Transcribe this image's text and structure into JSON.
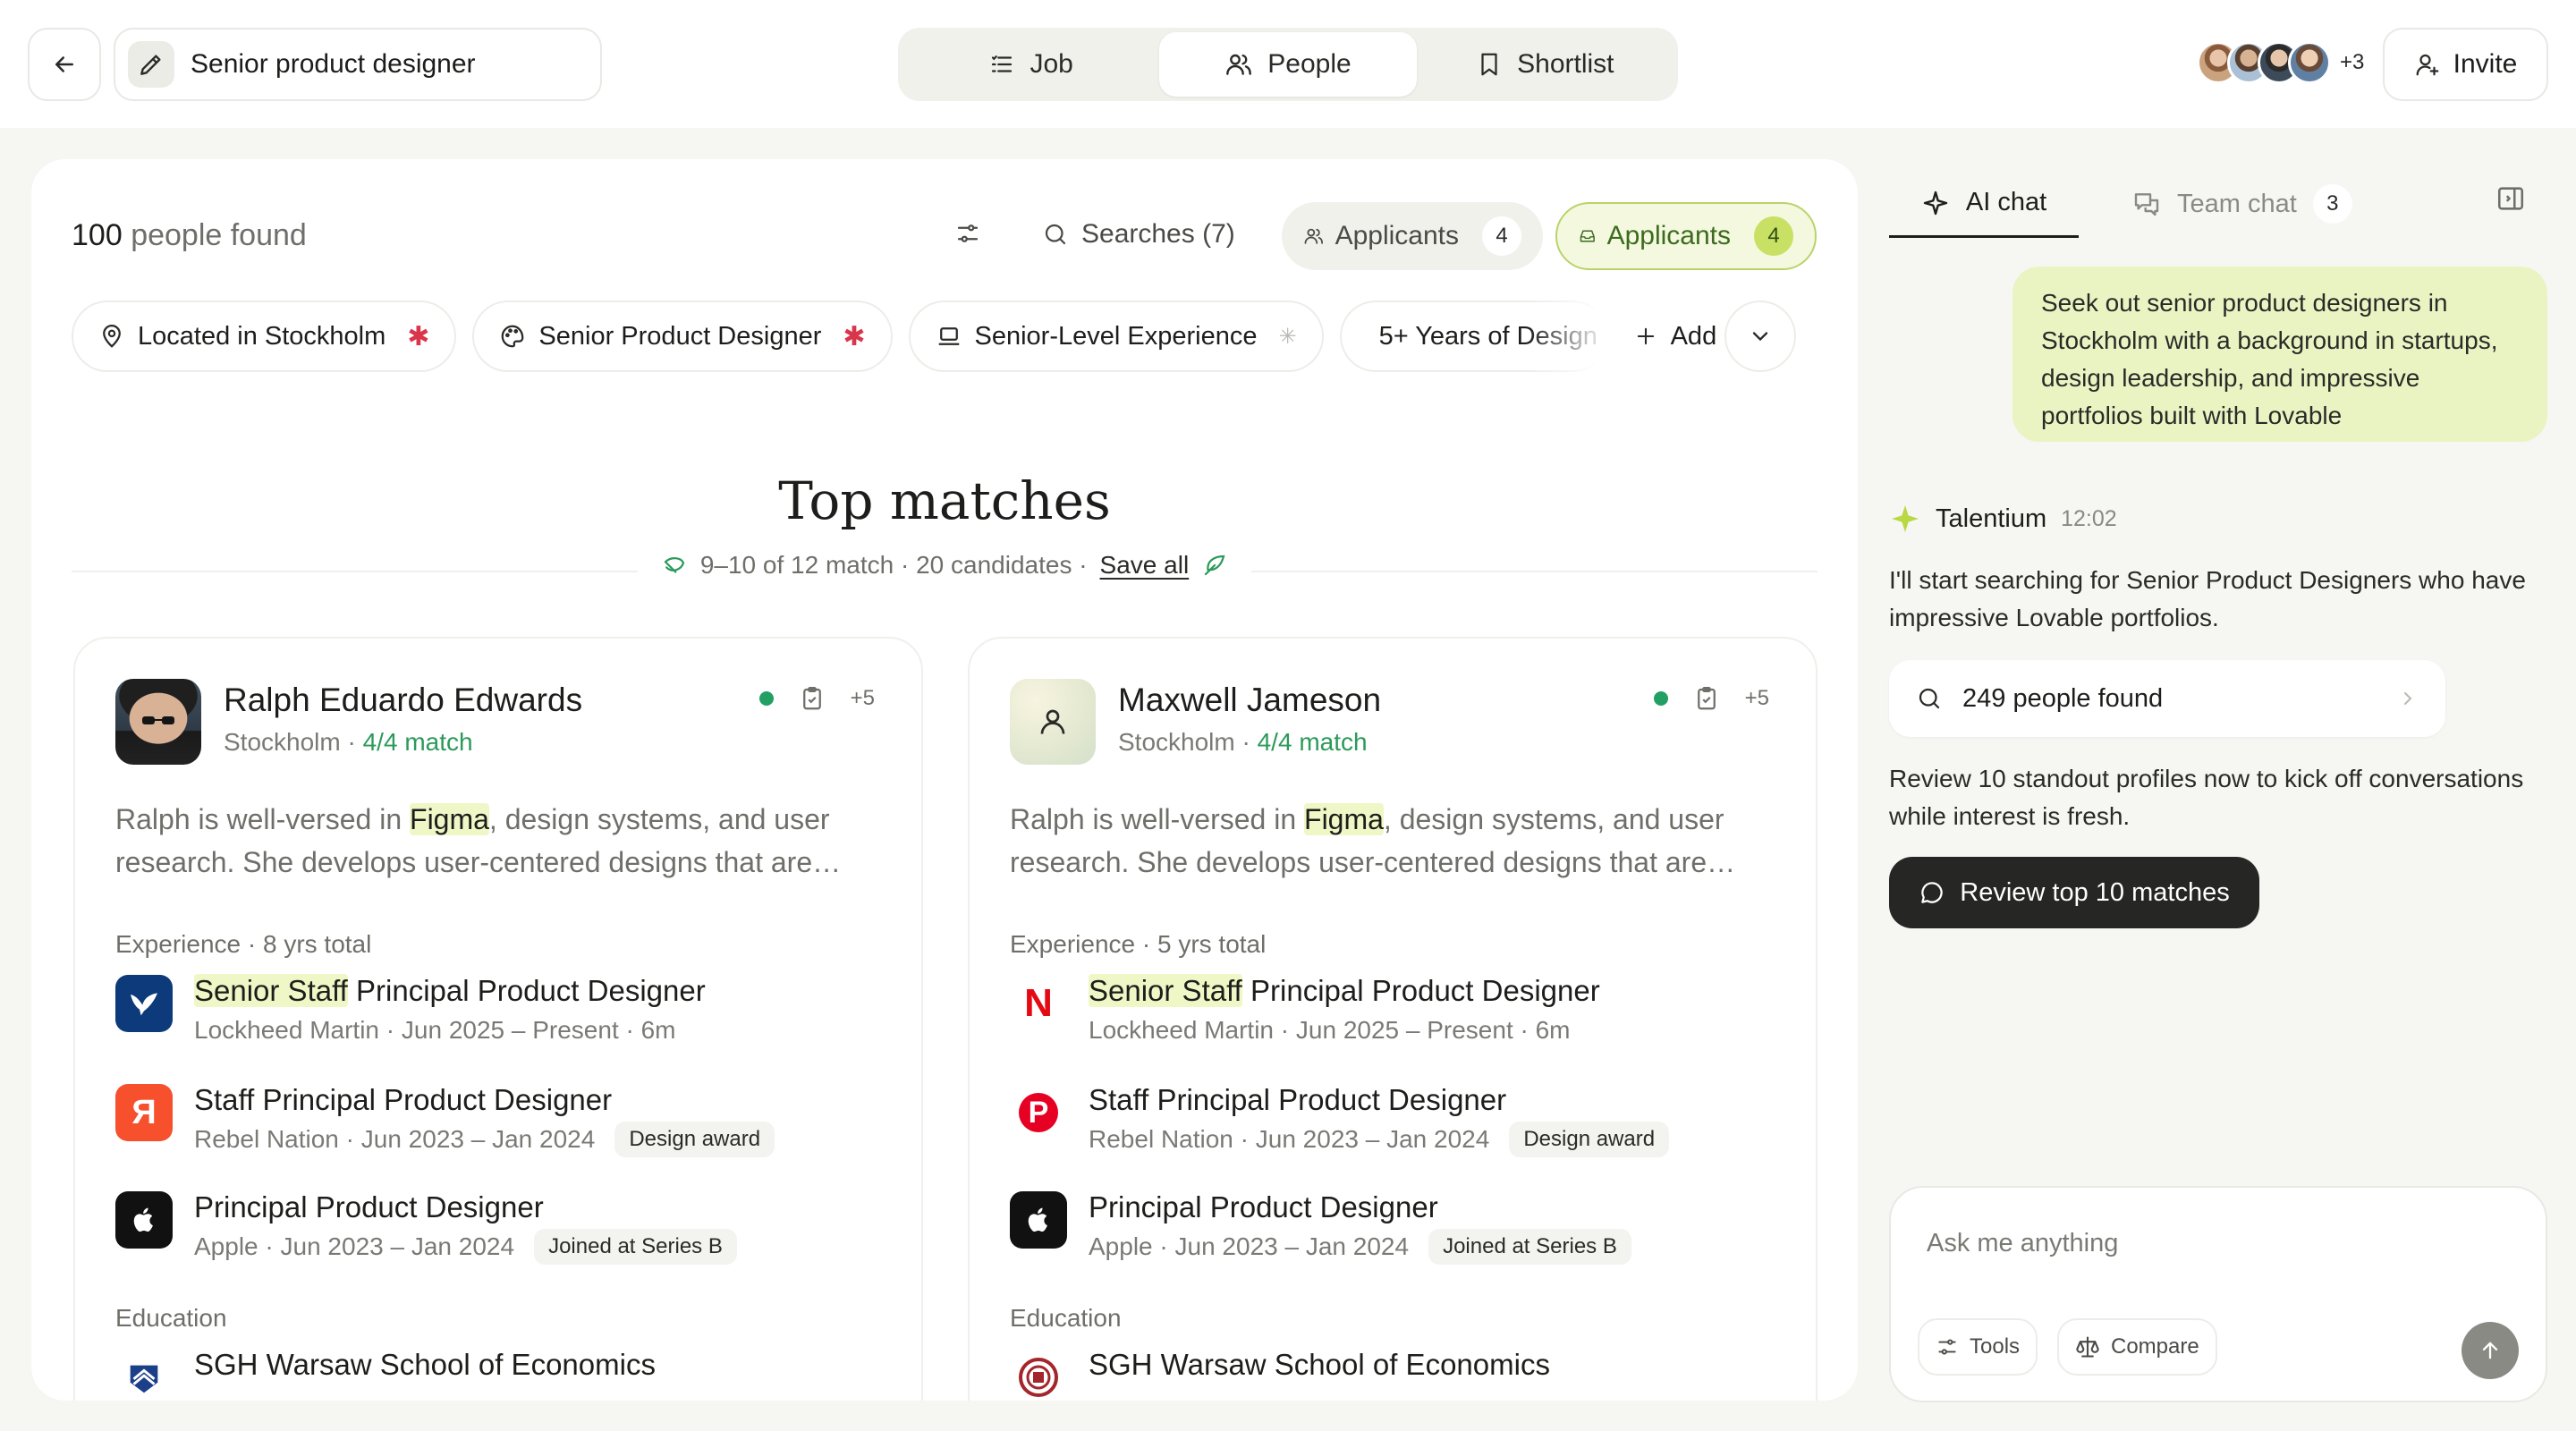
{
  "header": {
    "job_title": "Senior product designer",
    "tabs": [
      {
        "label": "Job"
      },
      {
        "label": "People"
      },
      {
        "label": "Shortlist"
      }
    ],
    "avatars_more": "+3",
    "invite_label": "Invite"
  },
  "results": {
    "count": "100",
    "count_suffix": "people found",
    "searches_label": "Searches (7)",
    "applicants_a": {
      "label": "Applicants",
      "count": "4"
    },
    "applicants_b": {
      "label": "Applicants",
      "count": "4"
    }
  },
  "filters": {
    "chips": [
      {
        "label": "Located in Stockholm"
      },
      {
        "label": "Senior Product Designer"
      },
      {
        "label": "Senior-Level Experience"
      },
      {
        "label": "5+ Years of Design"
      }
    ],
    "add_label": "Add"
  },
  "matches": {
    "title": "Top matches",
    "meta": "9–10 of 12 match · 20 candidates ·",
    "save_all": "Save all"
  },
  "candidates": [
    {
      "name": "Ralph Eduardo Edwards",
      "location": "Stockholm",
      "match": "4/4 match",
      "plus": "+5",
      "desc_pre": "Ralph is well-versed in ",
      "desc_hl": "Figma",
      "desc_post": ", design systems, and user research. She develops user-centered designs that are…",
      "exp_header": "Experience · 8 yrs total",
      "exp": [
        {
          "title_hl": "Senior Staff",
          "title": " Principal Product Designer",
          "sub": "Lockheed Martin · Jun 2025 – Present · 6m",
          "tag": ""
        },
        {
          "title_hl": "",
          "title": "Staff Principal Product Designer",
          "sub": "Rebel Nation · Jun 2023 – Jan 2024",
          "tag": "Design award"
        },
        {
          "title_hl": "",
          "title": "Principal Product Designer",
          "sub": "Apple · Jun 2023 – Jan 2024",
          "tag": "Joined at Series B"
        }
      ],
      "edu_header": "Education",
      "edu": "SGH Warsaw School of Economics"
    },
    {
      "name": "Maxwell Jameson",
      "location": "Stockholm",
      "match": "4/4 match",
      "plus": "+5",
      "desc_pre": "Ralph is well-versed in ",
      "desc_hl": "Figma",
      "desc_post": ", design systems, and user research. She develops user-centered designs that are…",
      "exp_header": "Experience · 5 yrs total",
      "exp": [
        {
          "title_hl": "Senior Staff",
          "title": " Principal Product Designer",
          "sub": "Lockheed Martin · Jun 2025 – Present · 6m",
          "tag": ""
        },
        {
          "title_hl": "",
          "title": "Staff Principal Product Designer",
          "sub": "Rebel Nation · Jun 2023 – Jan 2024",
          "tag": "Design award"
        },
        {
          "title_hl": "",
          "title": "Principal Product Designer",
          "sub": "Apple · Jun 2023 – Jan 2024",
          "tag": "Joined at Series B"
        }
      ],
      "edu_header": "Education",
      "edu": "SGH Warsaw School of Economics"
    }
  ],
  "chat": {
    "tab_ai": "AI chat",
    "tab_team": "Team chat",
    "team_count": "3",
    "user_message": "Seek out senior product designers in Stockholm with a background in startups, design leadership, and impressive portfolios built with Lovable",
    "bot_name": "Talentium",
    "bot_time": "12:02",
    "bot_msg_1": "I'll start searching for Senior Product Designers who have impressive Lovable portfolios.",
    "found_label": "249 people found",
    "bot_msg_2": "Review 10 standout profiles now to kick off conversations while interest is fresh.",
    "review_label": "Review top 10 matches",
    "composer_placeholder": "Ask me anything",
    "tools_label": "Tools",
    "compare_label": "Compare"
  },
  "colors": {
    "accent_green": "#c8e063",
    "match_green": "#2b9a5a",
    "required_star": "#d9364b",
    "user_bubble": "#eaf4c3"
  }
}
